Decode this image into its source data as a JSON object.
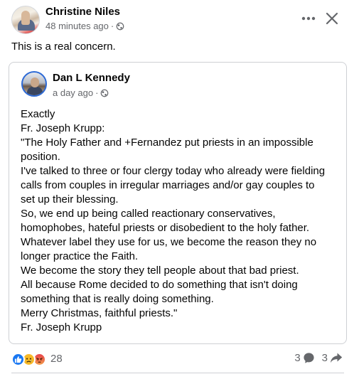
{
  "post": {
    "author": "Christine Niles",
    "timestamp": "48 minutes ago",
    "separator": "·",
    "audience_icon": "globe-icon",
    "text": "This is a real concern."
  },
  "shared": {
    "author": "Dan L Kennedy",
    "timestamp": "a day ago",
    "separator": "·",
    "audience_icon": "globe-icon",
    "lines": [
      "Exactly",
      "Fr. Joseph Krupp:",
      "\"The Holy Father and +Fernandez put priests in an impossible",
      "position.",
      "I've talked to three or four clergy today who already were fielding",
      "calls from couples in irregular marriages and/or gay couples to",
      "set up their blessing.",
      "So, we end up being called reactionary conservatives,",
      "homophobes, hateful priests or disobedient to the holy father.",
      "Whatever label they use for us, we become the reason they no",
      "longer practice the Faith.",
      "We become the story they tell people about that bad priest.",
      "All because Rome decided to do something that isn't doing",
      "something that is really doing something.",
      "Merry Christmas, faithful priests.\"",
      "Fr. Joseph Krupp"
    ]
  },
  "footer": {
    "reactions": [
      "like",
      "sad",
      "angry"
    ],
    "reaction_count": "28",
    "comment_count": "3",
    "share_count": "3"
  },
  "colors": {
    "like": "#1877f2",
    "sad": "#f7b928",
    "angry": "#e9414b",
    "secondary_text": "#65676b"
  }
}
